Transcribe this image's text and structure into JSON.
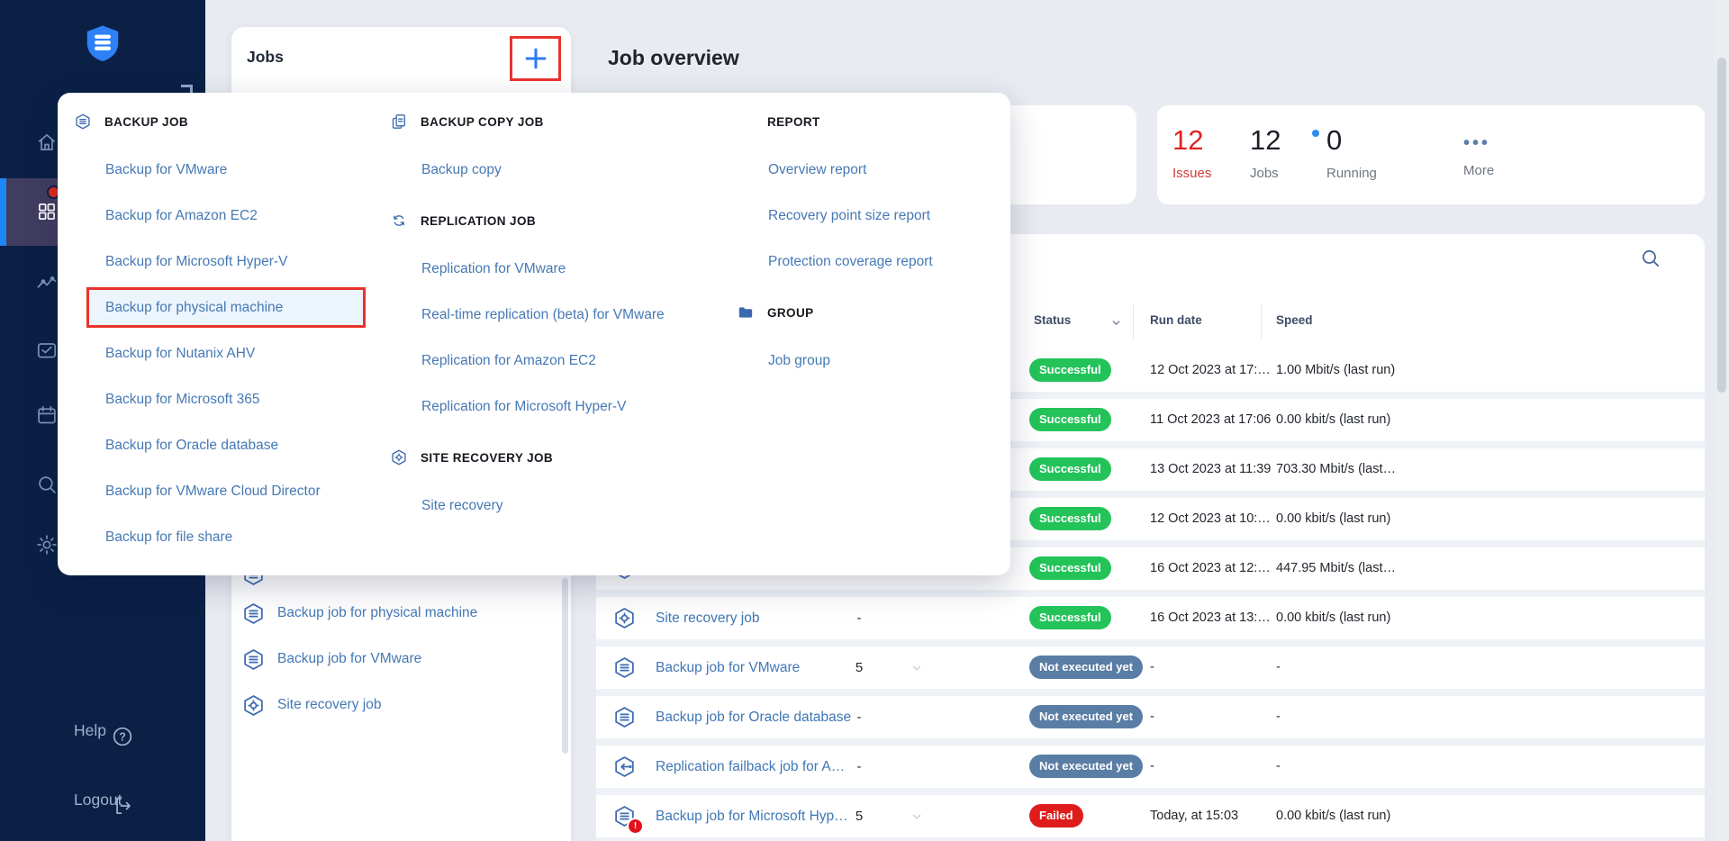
{
  "page": {
    "title": "Job overview"
  },
  "sidebar": {
    "logo": "shield-logo",
    "items": [
      {
        "icon": "home",
        "active": false
      },
      {
        "icon": "dashboard-grid",
        "active": true,
        "notification": true
      },
      {
        "icon": "activity",
        "active": false
      },
      {
        "icon": "monitoring",
        "active": false
      },
      {
        "icon": "calendar",
        "active": false
      },
      {
        "icon": "search",
        "active": false
      },
      {
        "icon": "settings",
        "active": false
      }
    ],
    "help_label": "Help",
    "logout_label": "Logout"
  },
  "jobs_panel": {
    "title": "Jobs",
    "add_button_label": "+",
    "visible_items": [
      {
        "icon": "stack",
        "label": "Backup job for physical machine"
      },
      {
        "icon": "stack",
        "label": "Backup job for VMware"
      },
      {
        "icon": "site-recovery",
        "label": "Site recovery job"
      }
    ]
  },
  "create_menu": {
    "columns": [
      {
        "sections": [
          {
            "header": "BACKUP JOB",
            "icon": "stack",
            "items": [
              {
                "label": "Backup for VMware"
              },
              {
                "label": "Backup for Amazon EC2"
              },
              {
                "label": "Backup for Microsoft Hyper-V"
              },
              {
                "label": "Backup for physical machine",
                "highlighted": true
              },
              {
                "label": "Backup for Nutanix AHV"
              },
              {
                "label": "Backup for Microsoft 365"
              },
              {
                "label": "Backup for Oracle database"
              },
              {
                "label": "Backup for VMware Cloud Director"
              },
              {
                "label": "Backup for file share"
              }
            ]
          }
        ]
      },
      {
        "sections": [
          {
            "header": "BACKUP COPY JOB",
            "icon": "copy",
            "items": [
              {
                "label": "Backup copy"
              }
            ]
          },
          {
            "header": "REPLICATION JOB",
            "icon": "replication",
            "items": [
              {
                "label": "Replication for VMware"
              },
              {
                "label": "Real-time replication (beta) for VMware"
              },
              {
                "label": "Replication for Amazon EC2"
              },
              {
                "label": "Replication for Microsoft Hyper-V"
              }
            ]
          },
          {
            "header": "SITE RECOVERY JOB",
            "icon": "site-recovery",
            "items": [
              {
                "label": "Site recovery"
              }
            ]
          }
        ]
      },
      {
        "sections": [
          {
            "header": "REPORT",
            "icon": "",
            "items": [
              {
                "label": "Overview report"
              },
              {
                "label": "Recovery point size report"
              },
              {
                "label": "Protection coverage report"
              }
            ]
          },
          {
            "header": "GROUP",
            "icon": "folder",
            "items": [
              {
                "label": "Job group"
              }
            ]
          }
        ]
      }
    ]
  },
  "stats": {
    "cards": [
      {
        "value": "12",
        "label": "Issues",
        "style": "alert"
      },
      {
        "value": "12",
        "label": "Jobs",
        "style": "normal"
      },
      {
        "value": "0",
        "label": "Running",
        "style": "running-dot"
      },
      {
        "value": "•••",
        "label": "More",
        "style": "more-dots"
      }
    ]
  },
  "table": {
    "columns": {
      "status": "Status",
      "run_date": "Run date",
      "speed": "Speed"
    },
    "rows": [
      {
        "icon": "",
        "name": "",
        "count": "",
        "chevron": false,
        "status": "Successful",
        "status_type": "success",
        "run_date": "12 Oct 2023 at 17:…",
        "speed": "1.00 Mbit/s (last run)"
      },
      {
        "icon": "",
        "name": "",
        "count": "",
        "chevron": false,
        "status": "Successful",
        "status_type": "success",
        "run_date": "11 Oct 2023 at 17:06",
        "speed": "0.00 kbit/s (last run)"
      },
      {
        "icon": "",
        "name": "",
        "count": "",
        "chevron": false,
        "status": "Successful",
        "status_type": "success",
        "run_date": "13 Oct 2023 at 11:39",
        "speed": "703.30 Mbit/s (last…"
      },
      {
        "icon": "",
        "name": "",
        "count": "",
        "chevron": false,
        "status": "Successful",
        "status_type": "success",
        "run_date": "12 Oct 2023 at 10:…",
        "speed": "0.00 kbit/s (last run)"
      },
      {
        "icon": "stack",
        "name": "",
        "count": "",
        "chevron": false,
        "status": "Successful",
        "status_type": "success",
        "run_date": "16 Oct 2023 at 12:…",
        "speed": "447.95 Mbit/s (last…"
      },
      {
        "icon": "site-recovery",
        "name": "Site recovery job",
        "count": "-",
        "chevron": false,
        "status": "Successful",
        "status_type": "success",
        "run_date": "16 Oct 2023 at 13:…",
        "speed": "0.00 kbit/s (last run)"
      },
      {
        "icon": "stack",
        "name": "Backup job for VMware",
        "count": "5",
        "chevron": true,
        "status": "Not executed yet",
        "status_type": "pending",
        "run_date": "-",
        "speed": "-"
      },
      {
        "icon": "stack",
        "name": "Backup job for Oracle database",
        "count": "-",
        "chevron": false,
        "status": "Not executed yet",
        "status_type": "pending",
        "run_date": "-",
        "speed": "-"
      },
      {
        "icon": "failback",
        "name": "Replication failback job for A…",
        "count": "-",
        "chevron": false,
        "status": "Not executed yet",
        "status_type": "pending",
        "run_date": "-",
        "speed": "-"
      },
      {
        "icon": "stack",
        "name": "Backup job for Microsoft Hyp…",
        "count": "5",
        "chevron": true,
        "error": true,
        "status": "Failed",
        "status_type": "failed",
        "run_date": "Today, at 15:03",
        "speed": "0.00 kbit/s (last run)"
      }
    ]
  },
  "colors": {
    "accent_blue": "#2b7bf3",
    "annotation_red": "#e8332d",
    "success_green": "#23c35a",
    "pending_slate": "#5a7da5",
    "failed_red": "#de1c1c",
    "sidebar_navy": "#0a2045"
  }
}
